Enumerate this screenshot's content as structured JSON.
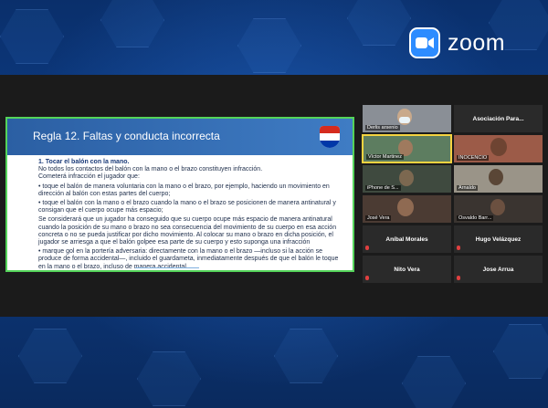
{
  "app": {
    "logo_text": "zoom",
    "brand_color": "#2d8cff"
  },
  "slide": {
    "title": "Regla 12. Faltas y conducta incorrecta",
    "lines": [
      {
        "text": "1. Tocar el balón con la mano.",
        "style": "heading"
      },
      {
        "text": "No todos los contactos del balón con la mano o el brazo constituyen infracción.",
        "style": "normal"
      },
      {
        "text": "Cometerá infracción el jugador que:",
        "style": "normal"
      },
      {
        "text": "• toque el balón de manera voluntaria con la mano o el brazo, por ejemplo, haciendo un movimiento en dirección al balón con estas partes del cuerpo;",
        "style": "normal"
      },
      {
        "text": "• toque el balón con la mano o el brazo cuando la mano o el brazo se posicionen de manera antinatural y consigan que el cuerpo ocupe más espacio;",
        "style": "normal"
      },
      {
        "text": "Se considerará que un jugador ha conseguido que su cuerpo ocupe más espacio de manera antinatural cuando la posición de su mano o brazo no sea consecuencia del movimiento de su cuerpo en esa acción concreta o no se pueda justificar por dicho movimiento. Al colocar su mano o brazo en dicha posición, el jugador se arriesga a que el balón golpee esa parte de su cuerpo y esto suponga una infracción",
        "style": "normal"
      },
      {
        "text": "• marque gol en la portería adversaria: directamente con la mano o el brazo —incluso si la acción se produce de forma accidental—, incluido el guardameta, inmediatamente después de que el balón le toque en la mano o el brazo, incluso de manera accidental",
        "style": "normal"
      }
    ]
  },
  "participants": [
    {
      "name": "Derlis arsenio",
      "type": "video",
      "active": false
    },
    {
      "name": "Asociación Para...",
      "type": "text",
      "active": false
    },
    {
      "name": "Víctor Martinez",
      "type": "video",
      "active": true
    },
    {
      "name": "INOCENCIO",
      "type": "video",
      "active": false
    },
    {
      "name": "iPhone de S...",
      "type": "video",
      "active": false
    },
    {
      "name": "Arnaldo",
      "type": "video",
      "active": false
    },
    {
      "name": "José Vera",
      "type": "video",
      "active": false
    },
    {
      "name": "Osvaldo Barr...",
      "type": "video",
      "active": false
    },
    {
      "name": "Aníbal Morales",
      "type": "text",
      "active": false
    },
    {
      "name": "Hugo Velázquez",
      "type": "text",
      "active": false
    },
    {
      "name": "Nito Vera",
      "type": "text",
      "active": false
    },
    {
      "name": "Jose Arrua",
      "type": "text",
      "active": false
    }
  ]
}
